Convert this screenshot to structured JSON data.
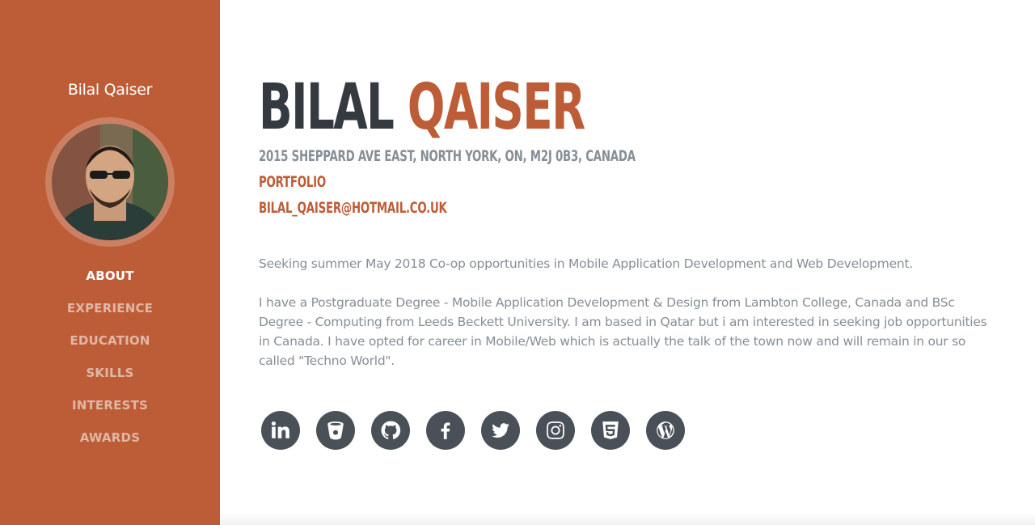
{
  "sidebar": {
    "brand": "Bilal Qaiser",
    "nav": [
      {
        "label": "ABOUT",
        "active": true
      },
      {
        "label": "EXPERIENCE",
        "active": false
      },
      {
        "label": "EDUCATION",
        "active": false
      },
      {
        "label": "SKILLS",
        "active": false
      },
      {
        "label": "INTERESTS",
        "active": false
      },
      {
        "label": "AWARDS",
        "active": false
      }
    ]
  },
  "about": {
    "first_name": "BILAL",
    "last_name": "QAISER",
    "address": "2015 SHEPPARD AVE EAST, NORTH YORK, ON, M2J 0B3, CANADA",
    "portfolio_label": "PORTFOLIO",
    "email": "BILAL_QAISER@HOTMAIL.CO.UK",
    "paragraph_1": "Seeking summer May 2018 Co-op opportunities in Mobile Application Development and Web Development.",
    "paragraph_2": "I have a Postgraduate Degree - Mobile Application Development & Design from Lambton College, Canada and BSc Degree - Computing from Leeds Beckett University. I am based in Qatar but i am interested in seeking job opportunities in Canada. I have opted for career in Mobile/Web which is actually the talk of the town now and will remain in our so called \"Techno World\"."
  },
  "social": [
    {
      "icon": "linkedin-icon"
    },
    {
      "icon": "bitbucket-icon"
    },
    {
      "icon": "github-icon"
    },
    {
      "icon": "facebook-icon"
    },
    {
      "icon": "twitter-icon"
    },
    {
      "icon": "instagram-icon"
    },
    {
      "icon": "html5-icon"
    },
    {
      "icon": "wordpress-icon"
    }
  ],
  "colors": {
    "accent": "#bd5d38",
    "dark": "#343a40",
    "muted": "#868e96",
    "icon_bg": "#495057"
  }
}
